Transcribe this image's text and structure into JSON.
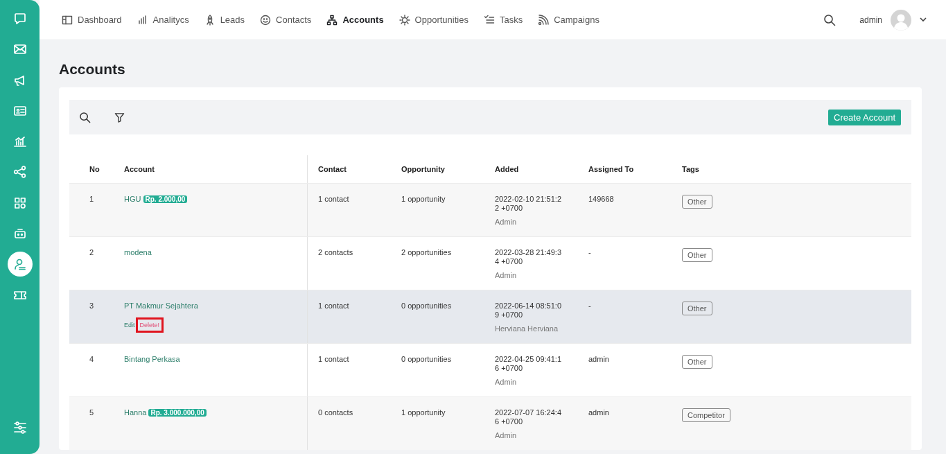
{
  "sidebar": {
    "items": [
      {
        "selected": false
      },
      {
        "selected": false
      },
      {
        "selected": false
      },
      {
        "selected": false
      },
      {
        "selected": false
      },
      {
        "selected": false
      },
      {
        "selected": false
      },
      {
        "selected": false
      },
      {
        "selected": true
      },
      {
        "selected": false
      }
    ]
  },
  "nav": {
    "tabs": [
      {
        "label": "Dashboard",
        "selected": false
      },
      {
        "label": "Analitycs",
        "selected": false
      },
      {
        "label": "Leads",
        "selected": false
      },
      {
        "label": "Contacts",
        "selected": false
      },
      {
        "label": "Accounts",
        "selected": true
      },
      {
        "label": "Opportunities",
        "selected": false
      },
      {
        "label": "Tasks",
        "selected": false
      },
      {
        "label": "Campaigns",
        "selected": false
      }
    ],
    "user": "admin"
  },
  "page_title": "Accounts",
  "toolbar": {
    "create_button": "Create Account"
  },
  "table": {
    "columns": [
      "No",
      "Account",
      "Contact",
      "Opportunity",
      "Added",
      "Assigned To",
      "Tags"
    ],
    "rows": [
      {
        "no": "1",
        "account": "HGU",
        "amount": "Rp. 2.000,00",
        "hovered": false,
        "actions": [],
        "contact": "1 contact",
        "opportunity": "1 opportunity",
        "added": "2022-02-10 21:51:22 +0700",
        "added_by": "Admin",
        "assigned_to": "149668",
        "tag": "Other"
      },
      {
        "no": "2",
        "account": "modena",
        "hovered": false,
        "actions": [],
        "contact": "2 contacts",
        "opportunity": "2 opportunities",
        "added": "2022-03-28 21:49:34 +0700",
        "added_by": "Admin",
        "assigned_to": "-",
        "tag": "Other"
      },
      {
        "no": "3",
        "account": "PT Makmur Sejahtera",
        "hovered": true,
        "actions": [
          {
            "label": "Edit",
            "kind": "edit",
            "highlighted": false
          },
          {
            "label": "Delete!",
            "kind": "delete",
            "highlighted": true
          }
        ],
        "contact": "1 contact",
        "opportunity": "0 opportunities",
        "added": "2022-06-14 08:51:09 +0700",
        "added_by": "Herviana Herviana",
        "assigned_to": "-",
        "tag": "Other"
      },
      {
        "no": "4",
        "account": "Bintang Perkasa",
        "hovered": false,
        "actions": [],
        "contact": "1 contact",
        "opportunity": "0 opportunities",
        "added": "2022-04-25 09:41:16 +0700",
        "added_by": "Admin",
        "assigned_to": "admin",
        "tag": "Other"
      },
      {
        "no": "5",
        "account": "Hanna",
        "amount": "Rp. 3.000.000,00",
        "hovered": false,
        "actions": [],
        "contact": "0 contacts",
        "opportunity": "1 opportunity",
        "added": "2022-07-07 16:24:46 +0700",
        "added_by": "Admin",
        "assigned_to": "admin",
        "tag": "Competitor"
      }
    ]
  }
}
